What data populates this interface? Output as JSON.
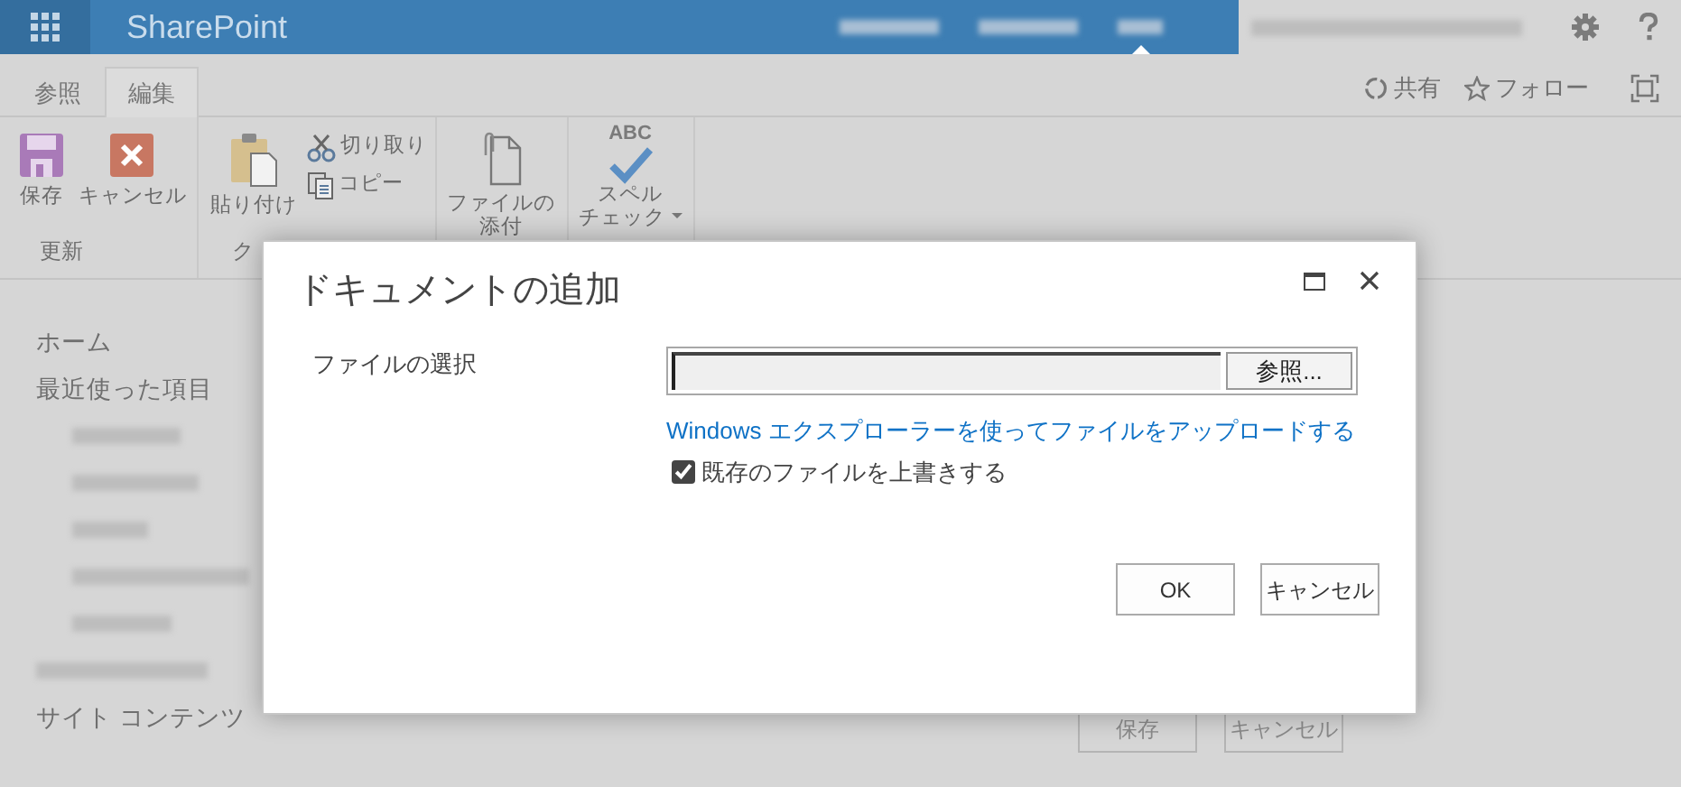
{
  "top_bar": {
    "app_name": "SharePoint",
    "nav": [
      {
        "kind": "blurred",
        "selected": false
      },
      {
        "kind": "blurred",
        "selected": false
      },
      {
        "kind": "blurred",
        "selected": true
      }
    ],
    "user": {
      "kind": "blurred"
    }
  },
  "ribbon": {
    "tabs": [
      {
        "label": "参照",
        "selected": false
      },
      {
        "label": "編集",
        "selected": true
      }
    ],
    "actions": [
      {
        "label": "共有",
        "kind": "share"
      },
      {
        "label": "フォロー",
        "kind": "follow"
      }
    ],
    "groups": [
      {
        "label": "更新",
        "commands": [
          {
            "kind": "save",
            "lines": [
              "保存"
            ]
          },
          {
            "kind": "cancel",
            "lines": [
              "キャンセル"
            ]
          }
        ]
      },
      {
        "label": "ク",
        "commands": [
          {
            "kind": "paste",
            "lines": [
              "貼り付け"
            ]
          },
          {
            "kind": "cut",
            "lines": [
              "切り取り"
            ]
          },
          {
            "kind": "copy",
            "lines": [
              "コピー"
            ]
          }
        ]
      },
      {
        "commands": [
          {
            "kind": "attach",
            "lines": [
              "ファイルの",
              "添付"
            ]
          }
        ]
      },
      {
        "commands": [
          {
            "kind": "spell",
            "icon_text": "ABC",
            "lines": [
              "スペル",
              "チェック"
            ],
            "dropdown": true
          }
        ]
      }
    ]
  },
  "left_nav": [
    {
      "kind": "text",
      "label": "ホーム"
    },
    {
      "kind": "text",
      "label": "最近使った項目",
      "children": [
        {
          "kind": "blurred"
        },
        {
          "kind": "blurred"
        },
        {
          "kind": "blurred"
        },
        {
          "kind": "blurred"
        },
        {
          "kind": "blurred"
        }
      ]
    },
    {
      "kind": "blurred"
    },
    {
      "kind": "text",
      "label": "サイト コンテンツ"
    }
  ],
  "form_buttons": [
    "保存",
    "キャンセル"
  ],
  "dialog": {
    "title": "ドキュメントの追加",
    "field_label": "ファイルの選択",
    "browse_button": "参照...",
    "link": "Windows エクスプローラーを使ってファイルをアップロードする",
    "checkbox": {
      "label": "既存のファイルを上書きする",
      "checked": true
    },
    "buttons": [
      "OK",
      "キャンセル"
    ]
  }
}
